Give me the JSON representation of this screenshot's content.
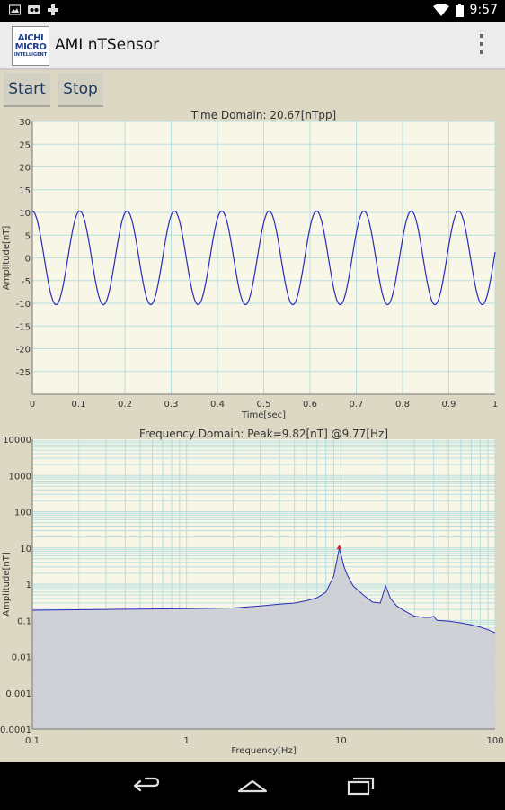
{
  "status_bar": {
    "time": "9:57",
    "icons": [
      "photo-icon",
      "voicemail-icon",
      "game-controller-icon",
      "wifi-icon",
      "battery-icon"
    ]
  },
  "action_bar": {
    "logo_lines": [
      "AICHI",
      "MICRO",
      "INTELLIGENT"
    ],
    "title": "AMI nTSensor",
    "overflow_icon": "more-vertical-icon"
  },
  "controls": {
    "start_label": "Start",
    "stop_label": "Stop"
  },
  "colors": {
    "plot_background": "#f8f6e6",
    "grid": "#b8dfe0",
    "trace": "#2b2bb8",
    "spectrum_fill": "#cccdd6",
    "peak_marker": "#e02020"
  },
  "chart_data": [
    {
      "type": "line",
      "title": "Time Domain: 20.67[nTpp]",
      "xlabel": "Time[sec]",
      "ylabel": "Amplitude[nT]",
      "xlim": [
        0,
        1
      ],
      "ylim": [
        -30,
        30
      ],
      "xticks": [
        "0",
        "0.1",
        "0.2",
        "0.3",
        "0.4",
        "0.5",
        "0.6",
        "0.7",
        "0.8",
        "0.9",
        "1"
      ],
      "yticks": [
        "30",
        "25",
        "20",
        "15",
        "10",
        "5",
        "0",
        "-5",
        "-10",
        "-15",
        "-20",
        "-25"
      ],
      "grid": true,
      "series": [
        {
          "frequency_hz": 9.77,
          "amplitude_nt": 10.3,
          "phase_cycles": 0.25
        }
      ]
    },
    {
      "type": "area",
      "title": "Frequency Domain: Peak=9.82[nT] @9.77[Hz]",
      "xlabel": "Frequency[Hz]",
      "ylabel": "Amplitude[nT]",
      "xscale": "log",
      "yscale": "log",
      "xlim": [
        0.1,
        100
      ],
      "ylim": [
        0.0001,
        10000
      ],
      "xticks": [
        "0.1",
        "1",
        "10",
        "100"
      ],
      "yticks": [
        "10000",
        "1000",
        "100",
        "10",
        "1",
        "0.1",
        "0.01",
        "0.001",
        "0.0001"
      ],
      "grid": true,
      "peak": {
        "x": 9.77,
        "y": 9.82
      },
      "series": [
        {
          "x": [
            0.1,
            0.3,
            1,
            2,
            3,
            4,
            5,
            6,
            7,
            8,
            9,
            9.77,
            10.5,
            11,
            12,
            14,
            16,
            18,
            19.5,
            21,
            23,
            26,
            30,
            35,
            38,
            40,
            42,
            50,
            60,
            70,
            80,
            90,
            100
          ],
          "y": [
            0.19,
            0.2,
            0.21,
            0.22,
            0.25,
            0.28,
            0.3,
            0.35,
            0.42,
            0.6,
            1.7,
            9.82,
            3.0,
            1.8,
            0.9,
            0.5,
            0.32,
            0.3,
            0.9,
            0.4,
            0.25,
            0.18,
            0.13,
            0.12,
            0.12,
            0.13,
            0.1,
            0.095,
            0.085,
            0.075,
            0.065,
            0.055,
            0.045
          ]
        }
      ]
    }
  ]
}
